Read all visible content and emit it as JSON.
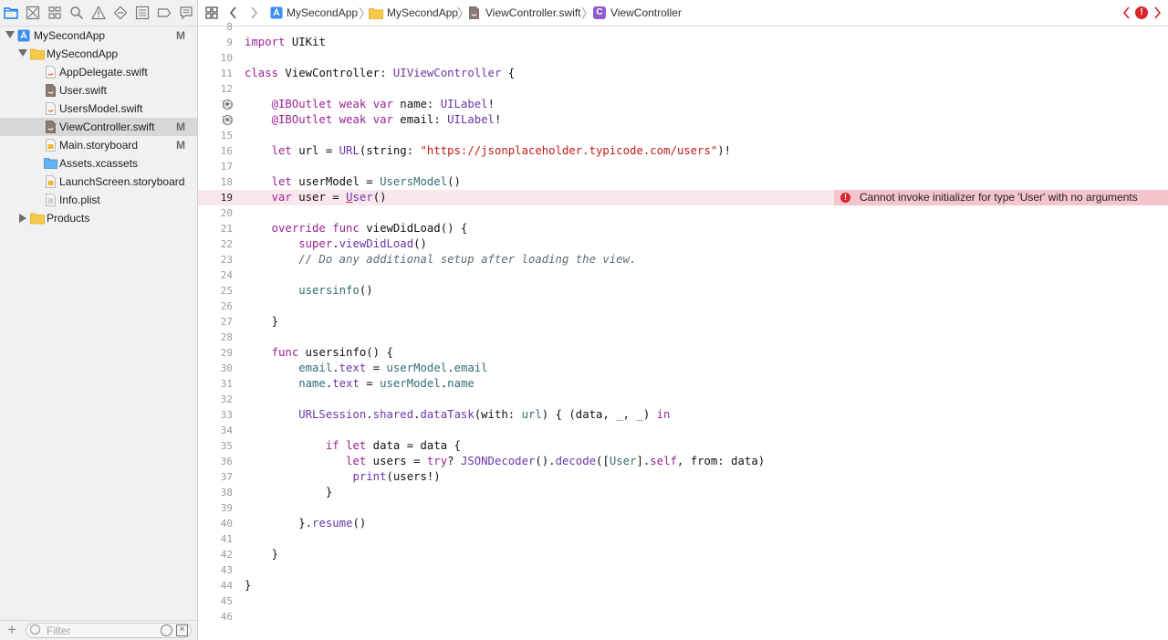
{
  "navigator": {
    "rows": [
      {
        "label": "MySecondApp",
        "badge": "M"
      },
      {
        "label": "MySecondApp",
        "badge": ""
      },
      {
        "label": "AppDelegate.swift",
        "badge": ""
      },
      {
        "label": "User.swift",
        "badge": ""
      },
      {
        "label": "UsersModel.swift",
        "badge": ""
      },
      {
        "label": "ViewController.swift",
        "badge": "M"
      },
      {
        "label": "Main.storyboard",
        "badge": "M"
      },
      {
        "label": "Assets.xcassets",
        "badge": ""
      },
      {
        "label": "LaunchScreen.storyboard",
        "badge": ""
      },
      {
        "label": "Info.plist",
        "badge": ""
      },
      {
        "label": "Products",
        "badge": ""
      }
    ],
    "filter_placeholder": "Filter"
  },
  "jumpbar": {
    "crumbs": [
      "MySecondApp",
      "MySecondApp",
      "ViewController.swift",
      "ViewController"
    ],
    "class_badge": "C",
    "issue_badge": "!"
  },
  "editor": {
    "line_numbers": [
      "8",
      "9",
      "10",
      "11",
      "12",
      "13",
      "14",
      "15",
      "16",
      "17",
      "18",
      "19",
      "20",
      "21",
      "22",
      "23",
      "24",
      "25",
      "26",
      "27",
      "28",
      "29",
      "30",
      "31",
      "32",
      "33",
      "34",
      "35",
      "36",
      "37",
      "38",
      "39",
      "40",
      "41",
      "42",
      "43",
      "44",
      "45",
      "46"
    ],
    "current_line": "19",
    "lines": [
      [],
      [
        {
          "t": "import",
          "c": "kw"
        },
        {
          "t": " UIKit",
          "c": "pl"
        }
      ],
      [],
      [
        {
          "t": "class",
          "c": "kw"
        },
        {
          "t": " ViewController: ",
          "c": "pl"
        },
        {
          "t": "UIViewController",
          "c": "ty"
        },
        {
          "t": " {",
          "c": "pl"
        }
      ],
      [],
      [
        {
          "t": "    @IBOutlet",
          "c": "kw"
        },
        {
          "t": " ",
          "c": "pl"
        },
        {
          "t": "weak",
          "c": "kw"
        },
        {
          "t": " ",
          "c": "pl"
        },
        {
          "t": "var",
          "c": "kw"
        },
        {
          "t": " name: ",
          "c": "pl"
        },
        {
          "t": "UILabel",
          "c": "ty"
        },
        {
          "t": "!",
          "c": "pl"
        }
      ],
      [
        {
          "t": "    @IBOutlet",
          "c": "kw"
        },
        {
          "t": " ",
          "c": "pl"
        },
        {
          "t": "weak",
          "c": "kw"
        },
        {
          "t": " ",
          "c": "pl"
        },
        {
          "t": "var",
          "c": "kw"
        },
        {
          "t": " email: ",
          "c": "pl"
        },
        {
          "t": "UILabel",
          "c": "ty"
        },
        {
          "t": "!",
          "c": "pl"
        }
      ],
      [],
      [
        {
          "t": "    let",
          "c": "kw"
        },
        {
          "t": " url = ",
          "c": "pl"
        },
        {
          "t": "URL",
          "c": "ty"
        },
        {
          "t": "(string: ",
          "c": "pl"
        },
        {
          "t": "\"https://jsonplaceholder.typicode.com/users\"",
          "c": "st"
        },
        {
          "t": ")!",
          "c": "pl"
        }
      ],
      [],
      [
        {
          "t": "    let",
          "c": "kw"
        },
        {
          "t": " userModel = ",
          "c": "pl"
        },
        {
          "t": "UsersModel",
          "c": "pr"
        },
        {
          "t": "()",
          "c": "pl"
        }
      ],
      [
        {
          "t": "    var",
          "c": "kw"
        },
        {
          "t": " user = ",
          "c": "pl"
        },
        {
          "t": "U",
          "c": "ty err-u"
        },
        {
          "t": "ser",
          "c": "ty"
        },
        {
          "t": "()",
          "c": "pl"
        }
      ],
      [],
      [
        {
          "t": "    override",
          "c": "kw"
        },
        {
          "t": " ",
          "c": "pl"
        },
        {
          "t": "func",
          "c": "kw"
        },
        {
          "t": " viewDidLoad() {",
          "c": "pl"
        }
      ],
      [
        {
          "t": "        super",
          "c": "kw"
        },
        {
          "t": ".",
          "c": "pl"
        },
        {
          "t": "viewDidLoad",
          "c": "ty"
        },
        {
          "t": "()",
          "c": "pl"
        }
      ],
      [
        {
          "t": "        // Do any additional setup after loading the view.",
          "c": "cm"
        }
      ],
      [],
      [
        {
          "t": "        usersinfo",
          "c": "pr"
        },
        {
          "t": "()",
          "c": "pl"
        }
      ],
      [],
      [
        {
          "t": "    }",
          "c": "pl"
        }
      ],
      [],
      [
        {
          "t": "    func",
          "c": "kw"
        },
        {
          "t": " usersinfo() {",
          "c": "pl"
        }
      ],
      [
        {
          "t": "        email",
          "c": "pr"
        },
        {
          "t": ".",
          "c": "pl"
        },
        {
          "t": "text",
          "c": "ty"
        },
        {
          "t": " = ",
          "c": "pl"
        },
        {
          "t": "userModel",
          "c": "pr"
        },
        {
          "t": ".",
          "c": "pl"
        },
        {
          "t": "email",
          "c": "pr"
        }
      ],
      [
        {
          "t": "        name",
          "c": "pr"
        },
        {
          "t": ".",
          "c": "pl"
        },
        {
          "t": "text",
          "c": "ty"
        },
        {
          "t": " = ",
          "c": "pl"
        },
        {
          "t": "userModel",
          "c": "pr"
        },
        {
          "t": ".",
          "c": "pl"
        },
        {
          "t": "name",
          "c": "pr"
        }
      ],
      [],
      [
        {
          "t": "        URLSession",
          "c": "ty"
        },
        {
          "t": ".",
          "c": "pl"
        },
        {
          "t": "shared",
          "c": "ty"
        },
        {
          "t": ".",
          "c": "pl"
        },
        {
          "t": "dataTask",
          "c": "ty"
        },
        {
          "t": "(with: ",
          "c": "pl"
        },
        {
          "t": "url",
          "c": "pr"
        },
        {
          "t": ") { (data, ",
          "c": "pl"
        },
        {
          "t": "_",
          "c": "kw"
        },
        {
          "t": ", ",
          "c": "pl"
        },
        {
          "t": "_",
          "c": "kw"
        },
        {
          "t": ") ",
          "c": "pl"
        },
        {
          "t": "in",
          "c": "kw"
        }
      ],
      [],
      [
        {
          "t": "            if",
          "c": "kw"
        },
        {
          "t": " ",
          "c": "pl"
        },
        {
          "t": "let",
          "c": "kw"
        },
        {
          "t": " data = data {",
          "c": "pl"
        }
      ],
      [
        {
          "t": "               let",
          "c": "kw"
        },
        {
          "t": " users = ",
          "c": "pl"
        },
        {
          "t": "try",
          "c": "kw"
        },
        {
          "t": "? ",
          "c": "pl"
        },
        {
          "t": "JSONDecoder",
          "c": "ty"
        },
        {
          "t": "().",
          "c": "pl"
        },
        {
          "t": "decode",
          "c": "ty"
        },
        {
          "t": "([",
          "c": "pl"
        },
        {
          "t": "User",
          "c": "pr"
        },
        {
          "t": "].",
          "c": "pl"
        },
        {
          "t": "self",
          "c": "kw"
        },
        {
          "t": ", from: data)",
          "c": "pl"
        }
      ],
      [
        {
          "t": "                print",
          "c": "ty"
        },
        {
          "t": "(users!)",
          "c": "pl"
        }
      ],
      [
        {
          "t": "            }",
          "c": "pl"
        }
      ],
      [],
      [
        {
          "t": "        }.",
          "c": "pl"
        },
        {
          "t": "resume",
          "c": "ty"
        },
        {
          "t": "()",
          "c": "pl"
        }
      ],
      [],
      [
        {
          "t": "    }",
          "c": "pl"
        }
      ],
      [],
      [
        {
          "t": "}",
          "c": "pl"
        }
      ],
      [],
      []
    ],
    "error_message": "Cannot invoke initializer for type 'User' with no arguments",
    "error_icon": "!"
  },
  "colors": {
    "error": "#d9252b",
    "folder": "#f7c948",
    "accent": "#1a7df5"
  }
}
